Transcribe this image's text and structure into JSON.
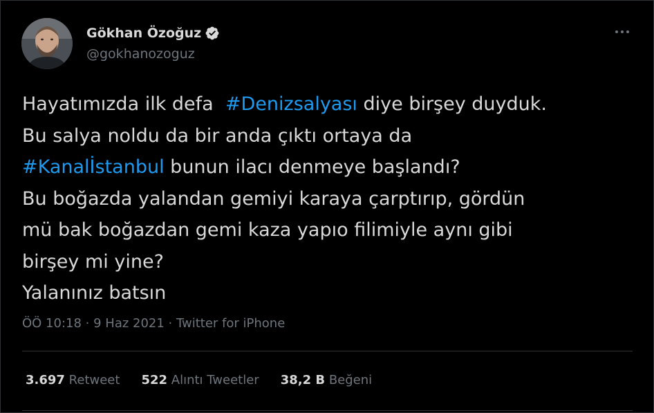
{
  "author": {
    "display_name": "Gökhan Özoğuz",
    "handle": "@gokhanozoguz",
    "verified": true
  },
  "tweet": {
    "lines": [
      {
        "segments": [
          {
            "text": "Hayatımızda ilk defa  ",
            "type": "text"
          },
          {
            "text": "#Denizsalyası",
            "type": "hashtag"
          },
          {
            "text": " diye birşey duyduk.",
            "type": "text"
          }
        ]
      },
      {
        "segments": [
          {
            "text": "Bu salya noldu da bir anda çıktı ortaya da",
            "type": "text"
          }
        ]
      },
      {
        "segments": [
          {
            "text": "#Kanalİstanbul",
            "type": "hashtag"
          },
          {
            "text": " bunun ilacı denmeye başlandı?",
            "type": "text"
          }
        ]
      },
      {
        "segments": [
          {
            "text": "Bu boğazda yalandan gemiyi karaya çarptırıp, gördün",
            "type": "text"
          }
        ]
      },
      {
        "segments": [
          {
            "text": "mü bak boğazdan gemi kaza yapıo filimiyle aynı gibi",
            "type": "text"
          }
        ]
      },
      {
        "segments": [
          {
            "text": "birşey mi yine?",
            "type": "text"
          }
        ]
      },
      {
        "segments": [
          {
            "text": "Yalanınız batsın",
            "type": "text"
          }
        ]
      }
    ]
  },
  "meta": {
    "time": "ÖÖ 10:18",
    "separator": " · ",
    "date": "9 Haz 2021",
    "source": "Twitter for iPhone"
  },
  "stats": {
    "retweets": {
      "count": "3.697",
      "label": "Retweet"
    },
    "quotes": {
      "count": "522",
      "label": "Alıntı Tweetler"
    },
    "likes": {
      "count": "38,2 B",
      "label": "Beğeni"
    }
  },
  "icons": {
    "verified": "verified-badge-icon",
    "more": "more-horizontal-icon"
  },
  "colors": {
    "background": "#000000",
    "text": "#d9d9d9",
    "secondary": "#6e767d",
    "accent": "#1d9bf0",
    "border": "#2f3336"
  }
}
